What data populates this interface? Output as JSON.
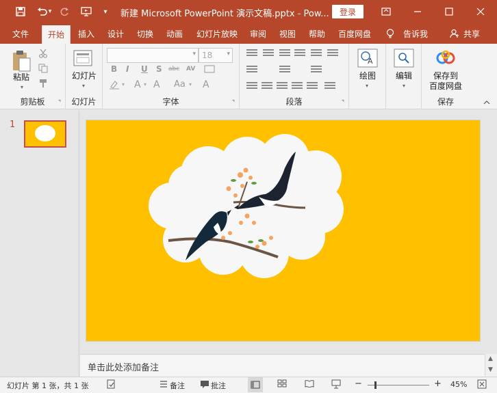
{
  "titlebar": {
    "title": "新建 Microsoft PowerPoint 演示文稿.pptx  -  Pow...",
    "login": "登录",
    "icons": [
      "save-icon",
      "undo-icon",
      "redo-icon",
      "start-from-beginning-icon",
      "customize-qat-icon"
    ],
    "undo_arrow": "▾",
    "qat_more": "▾"
  },
  "tabs": [
    "文件",
    "开始",
    "插入",
    "设计",
    "切换",
    "动画",
    "幻灯片放映",
    "审阅",
    "视图",
    "帮助",
    "百度网盘",
    "告诉我",
    "共享"
  ],
  "active_tab": "开始",
  "ribbon": {
    "clipboard": {
      "paste": "粘贴",
      "label": "剪贴板"
    },
    "slides": {
      "new_slide": "幻灯片",
      "label": "幻灯片"
    },
    "font": {
      "font_name": "",
      "font_size": "18",
      "label": "字体",
      "bold": "B",
      "italic": "I",
      "underline": "U",
      "shadow": "S",
      "strike": "abc",
      "spacing": "AV",
      "font_color": "A",
      "grow": "A",
      "change_case": "Aa",
      "clear": "A"
    },
    "paragraph": {
      "label": "段落"
    },
    "drawing": {
      "label": "绘图"
    },
    "editing": {
      "label": "编辑"
    },
    "baidu": {
      "save_to": "保存到",
      "baidu_disk": "百度网盘",
      "label": "保存"
    }
  },
  "thumbnails": [
    {
      "number": "1"
    }
  ],
  "notes": {
    "placeholder": "单击此处添加备注"
  },
  "status": {
    "slide_info": "幻灯片 第 1 张，共 1 张",
    "notes_btn": "备注",
    "comments_btn": "批注",
    "zoom_minus": "−",
    "zoom_plus": "+",
    "zoom": "45%",
    "zoom_level": 0.45
  },
  "colors": {
    "accent": "#b7472a",
    "slide_bg": "#ffc000"
  }
}
